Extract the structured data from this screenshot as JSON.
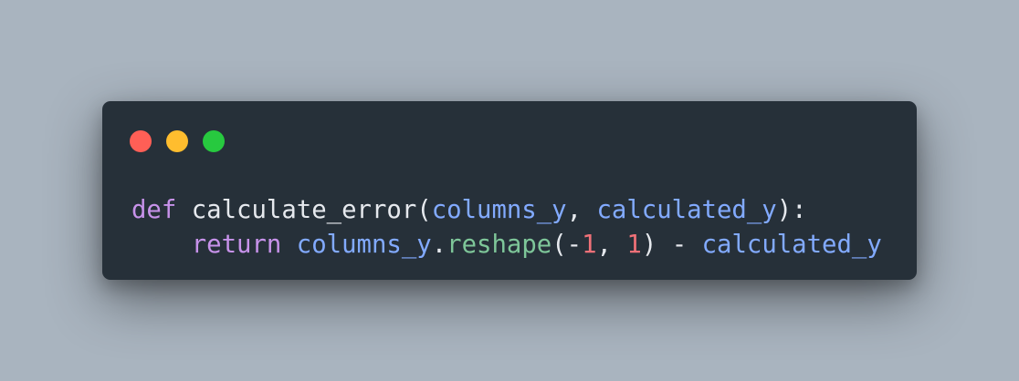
{
  "colors": {
    "background": "#a9b4bf",
    "window": "#263039",
    "dot_close": "#ff5f56",
    "dot_minimize": "#ffbd2e",
    "dot_maximize": "#27c93f",
    "keyword": "#c792ea",
    "identifier": "#82aaff",
    "method": "#7ec699",
    "number": "#f07178",
    "text": "#e6e9ee"
  },
  "window_controls": [
    "close-dot",
    "minimize-dot",
    "maximize-dot"
  ],
  "code": {
    "line1": {
      "keyword": "def",
      "function_name": "calculate_error",
      "open_paren": "(",
      "param1": "columns_y",
      "comma": ",",
      "param2": "calculated_y",
      "close": "):"
    },
    "line2": {
      "indent": "    ",
      "keyword": "return",
      "object": "columns_y",
      "dot": ".",
      "method": "reshape",
      "open_paren": "(",
      "minus": "-",
      "num1": "1",
      "comma": ",",
      "num2": "1",
      "close_paren": ")",
      "operator": "-",
      "operand": "calculated_y"
    }
  }
}
